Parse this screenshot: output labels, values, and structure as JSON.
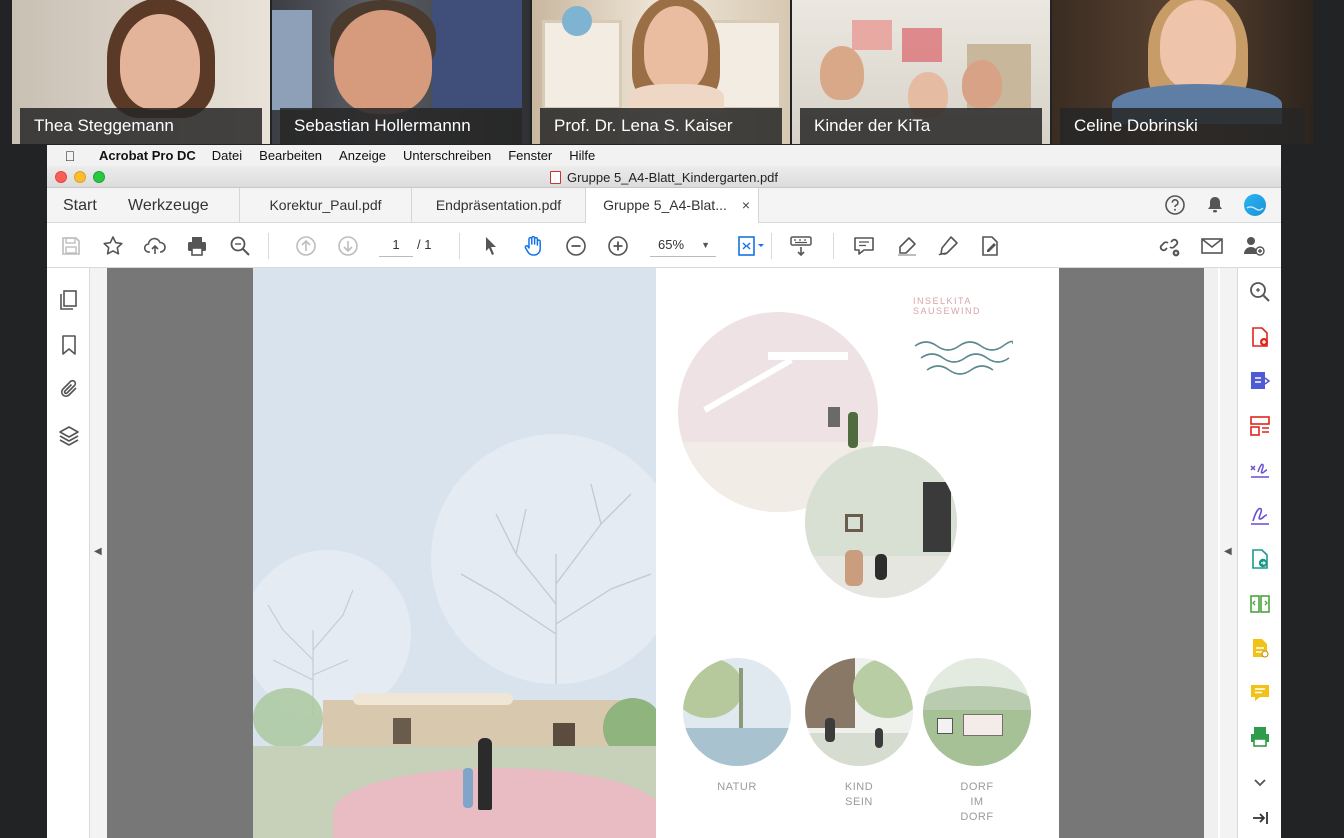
{
  "participants": [
    {
      "name": "Thea Steggemann"
    },
    {
      "name": "Sebastian Hollermannn"
    },
    {
      "name": "Prof. Dr. Lena S. Kaiser"
    },
    {
      "name": "Kinder der KiTa"
    },
    {
      "name": "Celine Dobrinski"
    }
  ],
  "menubar": {
    "app_name": "Acrobat Pro DC",
    "items": [
      "Datei",
      "Bearbeiten",
      "Anzeige",
      "Unterschreiben",
      "Fenster",
      "Hilfe"
    ]
  },
  "window": {
    "title": "Gruppe 5_A4-Blatt_Kindergarten.pdf"
  },
  "tabs": {
    "start": "Start",
    "tools": "Werkzeuge",
    "documents": [
      {
        "label": "Korektur_Paul.pdf"
      },
      {
        "label": "Endpräsentation.pdf"
      },
      {
        "label": "Gruppe 5_A4-Blat..."
      }
    ],
    "close_glyph": "×"
  },
  "toolbar": {
    "page_current": "1",
    "page_total": "/ 1",
    "zoom": "65%"
  },
  "document": {
    "logo_text": "INSELKITA SAUSEWIND",
    "captions": {
      "natur": "NATUR",
      "kind_sein_1": "KIND",
      "kind_sein_2": "SEIN",
      "dorf_1": "DORF",
      "dorf_2": "IM",
      "dorf_3": "DORF"
    }
  },
  "colors": {
    "accent_blue": "#1473e6",
    "adobe_red": "#e1251b",
    "pink_accent": "#e9c9cd"
  }
}
